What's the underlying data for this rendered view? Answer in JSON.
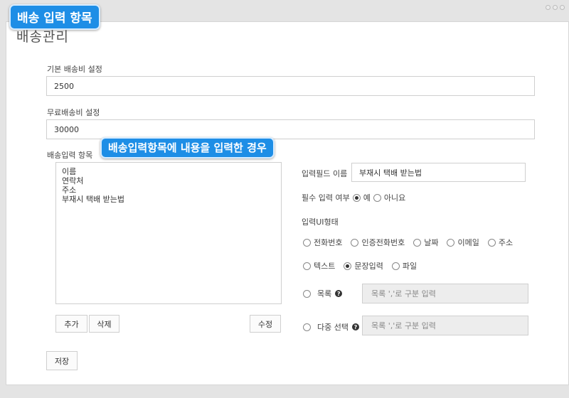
{
  "callouts": {
    "top": "배송 입력 항목",
    "middle": "배송입력항목에 내용을 입력한 경우"
  },
  "page_title": "배송관리",
  "base_fee": {
    "label": "기본 배송비 설정",
    "value": "2500"
  },
  "free_fee": {
    "label": "무료배송비 설정",
    "value": "30000"
  },
  "delivery_items": {
    "label": "배송입력 항목",
    "items": [
      "이름",
      "연락처",
      "주소",
      "부재시 택배 받는법"
    ]
  },
  "buttons": {
    "add": "추가",
    "delete": "삭제",
    "edit": "수정",
    "save": "저장"
  },
  "field_name": {
    "label": "입력필드 이름",
    "value": "부재시 택배 받는법"
  },
  "required": {
    "label": "필수 입력 여부",
    "yes": "예",
    "no": "아니요",
    "selected": "yes"
  },
  "ui_type": {
    "label": "입력UI형태",
    "options_row1": [
      "전화번호",
      "인증전화번호",
      "날짜",
      "이메일",
      "주소"
    ],
    "options_row2": [
      "텍스트",
      "문장입력",
      "파일"
    ],
    "selected": "문장입력"
  },
  "list_option": {
    "label": "목록",
    "placeholder": "목록 ','로 구분 입력"
  },
  "multi_option": {
    "label": "다중 선택",
    "placeholder": "목록 ','로 구분 입력"
  }
}
